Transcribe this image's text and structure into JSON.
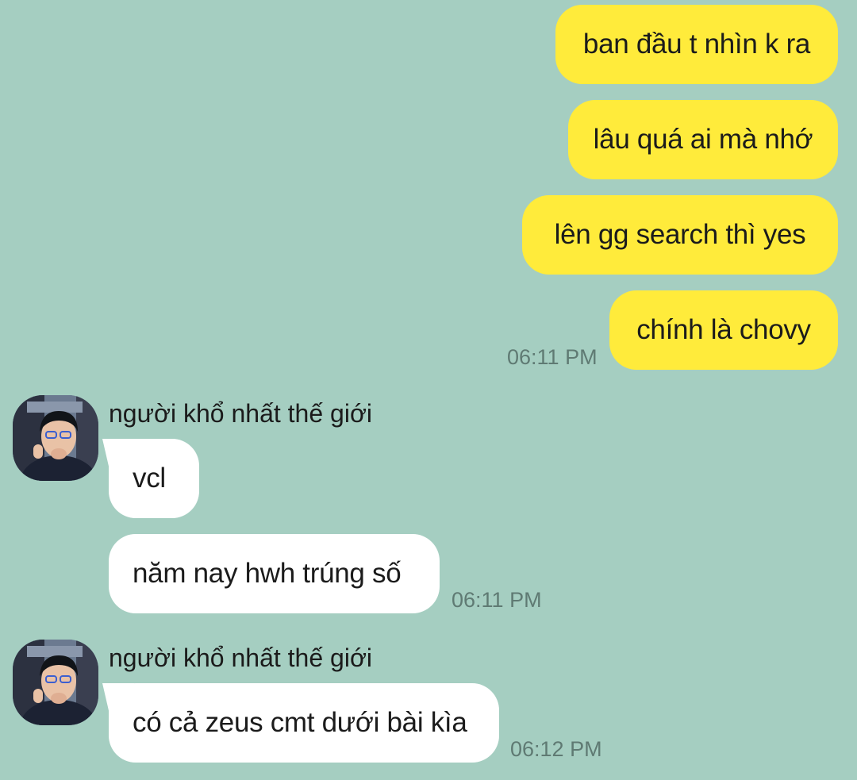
{
  "outgoing": [
    {
      "text": "ban đầu t nhìn k ra"
    },
    {
      "text": "lâu quá ai mà nhớ"
    },
    {
      "text": "lên gg search thì yes"
    },
    {
      "text": "chính là chovy",
      "time": "06:11 PM"
    }
  ],
  "groups": [
    {
      "sender": "người khổ nhất thế giới",
      "avatar_icon": "profile-photo",
      "messages": [
        {
          "text": "vcl"
        },
        {
          "text": "năm nay hwh trúng số",
          "time": "06:11 PM"
        }
      ]
    },
    {
      "sender": "người khổ nhất thế giới",
      "avatar_icon": "profile-photo",
      "messages": [
        {
          "text": "có cả zeus cmt dưới bài kìa",
          "time": "06:12 PM"
        }
      ]
    }
  ],
  "colors": {
    "background": "#a5cec1",
    "outgoing_bubble": "#ffeb3b",
    "incoming_bubble": "#ffffff",
    "timestamp": "#5f7a73"
  }
}
